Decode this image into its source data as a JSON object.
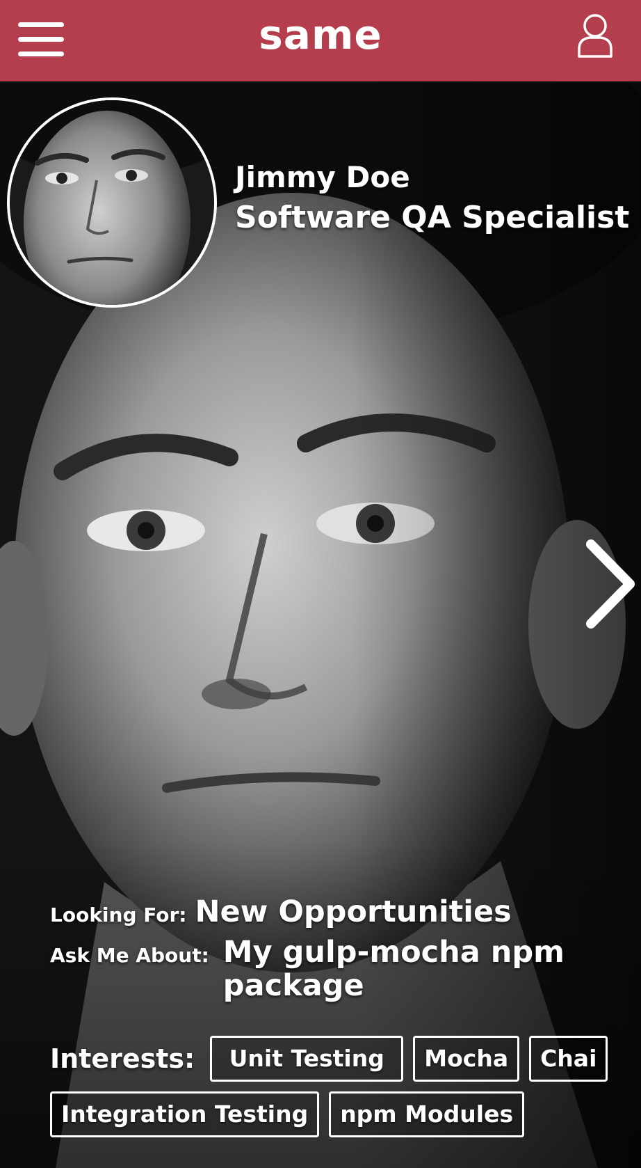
{
  "app": {
    "brand": "same"
  },
  "header": {
    "menu_icon": "hamburger-menu-icon",
    "profile_icon": "user-profile-icon",
    "background_color": "#b43d4e"
  },
  "profile": {
    "name": "Jimmy Doe",
    "title": "Software QA Specialist",
    "avatar": "profile-photo",
    "background": "profile-photo-full"
  },
  "details": {
    "looking_for_label": "Looking For:",
    "looking_for_value": "New Opportunities",
    "ask_me_label": "Ask Me About:",
    "ask_me_value": "My gulp-mocha npm package"
  },
  "interests": {
    "label": "Interests:",
    "tags": [
      "Unit Testing",
      "Mocha",
      "Chai",
      "Integration Testing",
      "npm Modules"
    ]
  },
  "navigation": {
    "next_icon": "chevron-right-icon"
  }
}
